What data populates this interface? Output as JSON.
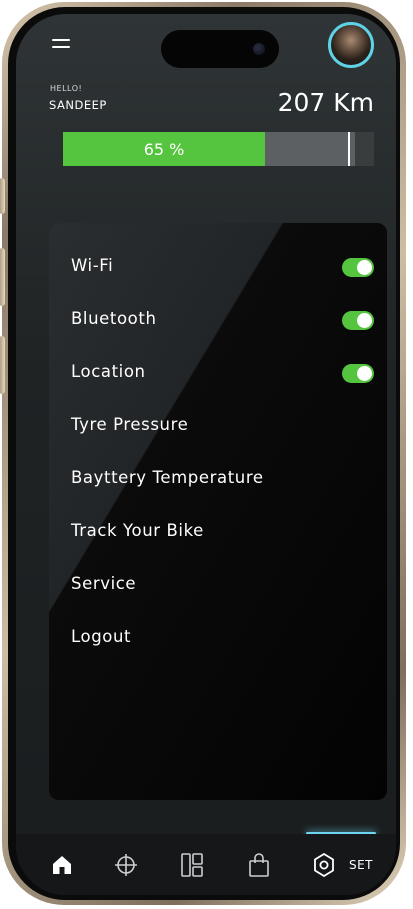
{
  "header": {
    "greeting": "HELLO!",
    "user_name": "SANDEEP",
    "distance": "207 Km"
  },
  "battery": {
    "level": 0.65,
    "label": "65 %"
  },
  "settings": [
    {
      "label": "Wi-Fi",
      "toggle": true
    },
    {
      "label": "Bluetooth",
      "toggle": true
    },
    {
      "label": "Location",
      "toggle": true
    },
    {
      "label": "Tyre Pressure"
    },
    {
      "label": "Bayttery Temperature"
    },
    {
      "label": "Track Your Bike"
    },
    {
      "label": "Service"
    },
    {
      "label": "Logout"
    }
  ],
  "nav": {
    "items": [
      "home-icon",
      "crosshair-icon",
      "dashboard-icon",
      "shopping-bag-icon",
      "settings-icon"
    ],
    "active_label": "SET"
  },
  "colors": {
    "accent_green": "#55c43e",
    "accent_cyan": "#5fd3e6"
  }
}
